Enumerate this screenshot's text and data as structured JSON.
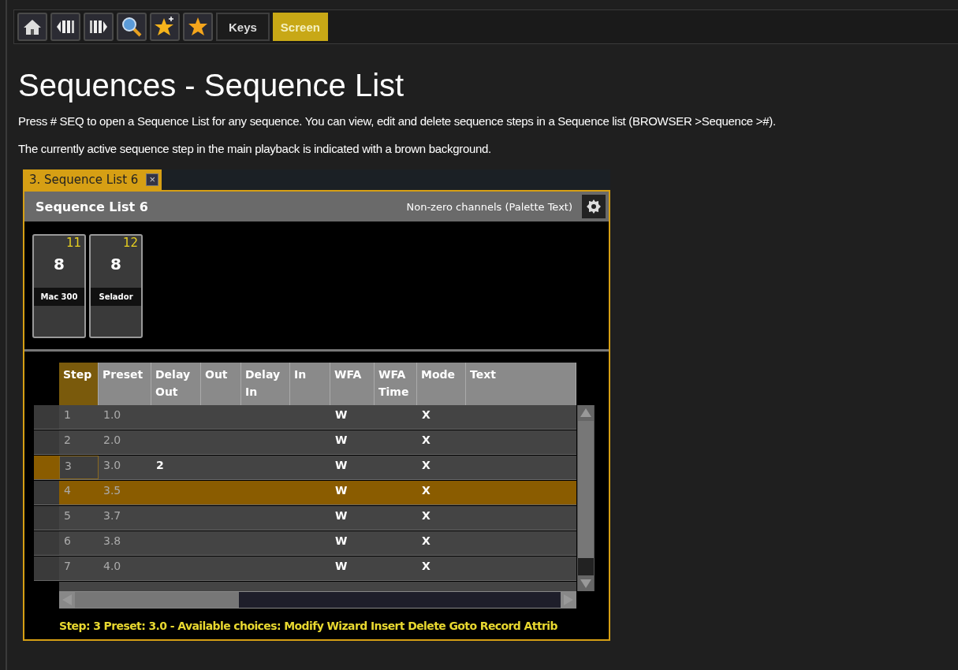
{
  "toolbar": {
    "buttons": [
      {
        "label": "Keys",
        "selected": false
      },
      {
        "label": "Screen",
        "selected": true
      }
    ]
  },
  "title": "Sequences - Sequence List",
  "paragraphs": [
    "Press # SEQ to open a Sequence List for any sequence. You can view, edit and delete sequence steps in a Sequence list (BROWSER >Sequence >#).",
    "The currently active sequence step in the main playback is indicated with a brown background."
  ],
  "tab": {
    "label": "3. Sequence List 6",
    "close": "×"
  },
  "panel": {
    "title": "Sequence List 6",
    "mode": "Non-zero channels (Palette Text)"
  },
  "fixtures": [
    {
      "number": "11",
      "value": "8",
      "name": "Mac 300"
    },
    {
      "number": "12",
      "value": "8",
      "name": "Selador"
    }
  ],
  "table": {
    "columns": [
      "Step",
      "Preset",
      "Delay Out",
      "Out",
      "Delay In",
      "In",
      "WFA",
      "WFA Time",
      "Mode",
      "Text"
    ],
    "rows": [
      {
        "cells": [
          "1",
          "1.0",
          "",
          "",
          "",
          "",
          "W",
          "",
          "X",
          ""
        ],
        "selected": false,
        "active": false
      },
      {
        "cells": [
          "2",
          "2.0",
          "",
          "",
          "",
          "",
          "W",
          "",
          "X",
          ""
        ],
        "selected": false,
        "active": false
      },
      {
        "cells": [
          "3",
          "3.0",
          "2",
          "",
          "",
          "",
          "W",
          "",
          "X",
          ""
        ],
        "selected": true,
        "active": false
      },
      {
        "cells": [
          "4",
          "3.5",
          "",
          "",
          "",
          "",
          "W",
          "",
          "X",
          ""
        ],
        "selected": false,
        "active": true
      },
      {
        "cells": [
          "5",
          "3.7",
          "",
          "",
          "",
          "",
          "W",
          "",
          "X",
          ""
        ],
        "selected": false,
        "active": false
      },
      {
        "cells": [
          "6",
          "3.8",
          "",
          "",
          "",
          "",
          "W",
          "",
          "X",
          ""
        ],
        "selected": false,
        "active": false
      },
      {
        "cells": [
          "7",
          "4.0",
          "",
          "",
          "",
          "",
          "W",
          "",
          "X",
          ""
        ],
        "selected": false,
        "active": false
      }
    ]
  },
  "status": "Step: 3 Preset: 3.0 - Available choices: Modify Wizard Insert Delete Goto Record Attrib"
}
